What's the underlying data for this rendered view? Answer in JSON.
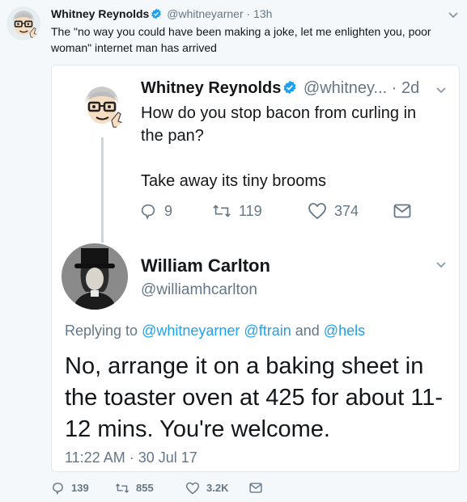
{
  "main_tweet": {
    "author_name": "Whitney Reynolds",
    "handle": "@whitneyarner",
    "separator": "·",
    "time": "13h",
    "text": "The \"no way you could have been making a joke, let me enlighten you, poor woman\" internet man has arrived",
    "actions": {
      "replies": "139",
      "retweets": "855",
      "likes": "3.2K"
    }
  },
  "quoted_tweet": {
    "author_name": "Whitney Reynolds",
    "handle": "@whitney...",
    "separator": "·",
    "time": "2d",
    "text_line1": "How do you stop bacon from curling in the pan?",
    "text_line2": "Take away its tiny brooms",
    "actions": {
      "replies": "9",
      "retweets": "119",
      "likes": "374"
    }
  },
  "reply_tweet": {
    "author_name": "William Carlton",
    "handle": "@williamhcarlton",
    "replying_prefix": "Replying to",
    "replying_to_1": "@whitneyarner",
    "replying_to_2": "@ftrain",
    "replying_and": "and",
    "replying_to_3": "@hels",
    "text": "No, arrange it on a baking sheet in the toaster oven at 425 for about 11-12 mins. You're welcome.",
    "timestamp": "11:22 AM · 30 Jul 17"
  },
  "icons": [
    "verified-badge-icon",
    "chevron-down-icon",
    "reply-icon",
    "retweet-icon",
    "like-icon",
    "direct-message-icon"
  ],
  "colors": {
    "link": "#1da1f2",
    "muted": "#657786",
    "verified": "#1da1f2",
    "thread_line": "#ccd6dd"
  }
}
